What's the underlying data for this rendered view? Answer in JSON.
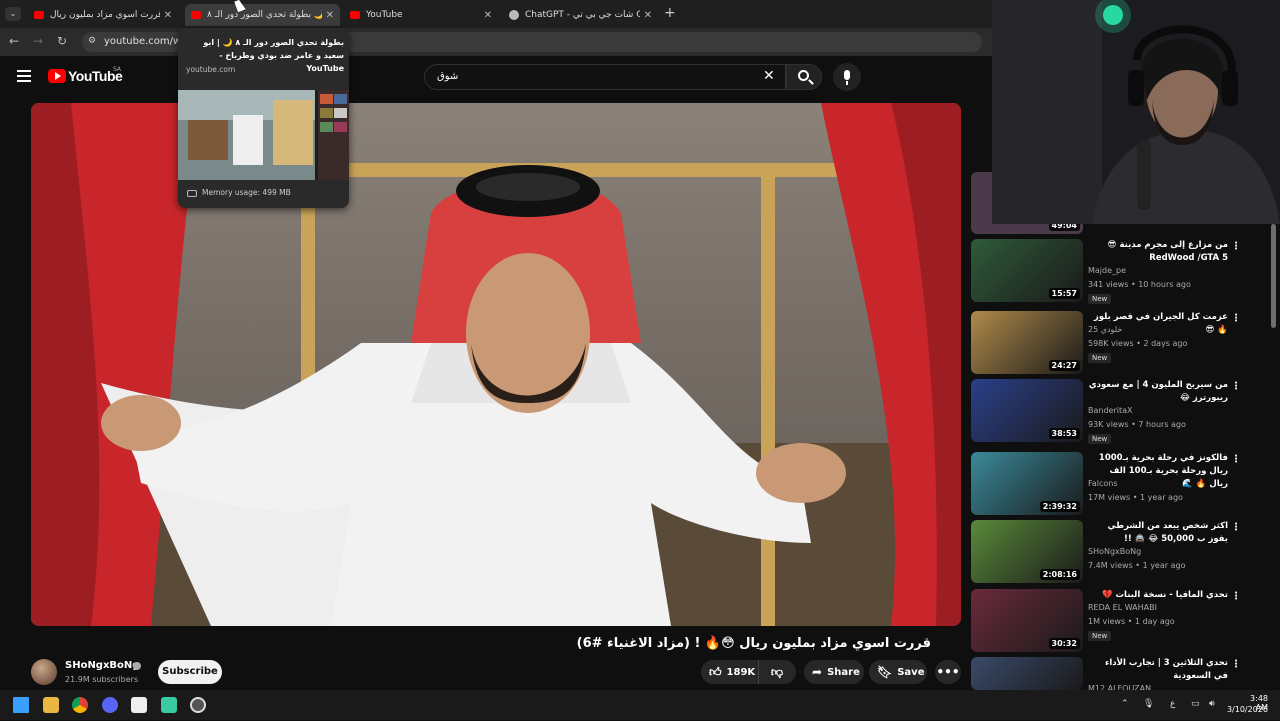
{
  "tabs": [
    {
      "title": "قررت اسوي مزاد بمليون ريال 😳",
      "favicon": "youtube-icon",
      "active": false
    },
    {
      "title": "بطولة تحدي الصور دور الـ ٨ 🌙",
      "favicon": "youtube-icon",
      "active": true
    },
    {
      "title": "YouTube",
      "favicon": "youtube-icon",
      "active": false
    },
    {
      "title": "ChatGPT - شات جي بي تي GPT",
      "favicon": "chatgpt-icon",
      "active": false
    }
  ],
  "address": {
    "url": "youtube.com/wat"
  },
  "hover_card": {
    "title": "بطولة تحدي الصور دور الـ ٨ 🌙 | ابو سعيد و عامر ضد بودي وطرباخ - YouTube",
    "domain": "youtube.com",
    "memory": "Memory usage: 499 MB"
  },
  "header": {
    "logo_text": "YouTube",
    "country": "SA",
    "search_value": "شوق"
  },
  "video": {
    "title": "قررت اسوي مزاد بمليون ريال 😳🔥 ! (مزاد الاغنياء #6)",
    "channel": "SHoNgxBoNg",
    "subscribers": "21.9M subscribers",
    "subscribe_label": "Subscribe",
    "likes": "189K",
    "share_label": "Share",
    "save_label": "Save"
  },
  "sidebar": {
    "partial_duration": "49:04",
    "items": [
      {
        "title": "من مزارع إلى مجرم مدينة 😎 RedWood /GTA 5",
        "channel": "Majde_pe",
        "meta": "341 views • 10 hours ago",
        "badge": "New",
        "duration": "15:57",
        "color": "#2f5a3a"
      },
      {
        "title": "عزمت كل الجيران في قصر بلوز 🔥 😎",
        "channel": "خلودي 25",
        "meta": "598K views • 2 days ago",
        "badge": "New",
        "duration": "24:27",
        "color": "#b08a4a"
      },
      {
        "title": "من سيربح المليون 4 | مع سعودي ريبورترز 😂",
        "channel": "BanderitaX",
        "meta": "93K views • 7 hours ago",
        "badge": "New",
        "duration": "38:53",
        "color": "#2a3f8a"
      },
      {
        "title": "فالكونز في رحلة بحرية بـ1000 ريال ورحلة بحرية بـ100 الف ريال 🔥 🌊",
        "channel": "Falcons",
        "meta": "17M views • 1 year ago",
        "badge": "",
        "duration": "2:39:32",
        "color": "#3a8a9a"
      },
      {
        "title": "اكثر شخص يبعد من الشرطي يفوز ب 50,000 😂 🚔 !!",
        "channel": "SHoNgxBoNg",
        "meta": "7.4M views • 1 year ago",
        "badge": "",
        "duration": "2:08:16",
        "color": "#5a8a3a"
      },
      {
        "title": "تحدي المافيا - نسخة البنات 💔",
        "channel": "REDA EL WAHABI",
        "meta": "1M views • 1 day ago",
        "badge": "New",
        "duration": "30:32",
        "color": "#6a2a3a"
      },
      {
        "title": "تحدي الثلاثين 3 | تجارب الأداء في السعودية",
        "channel": "M12 ALFOUZAN",
        "meta": "",
        "badge": "",
        "duration": "",
        "color": "#3a4a6a"
      }
    ]
  },
  "taskbar": {
    "time": "3:48 AM",
    "date": "3/10/2026",
    "lang": "ع"
  }
}
